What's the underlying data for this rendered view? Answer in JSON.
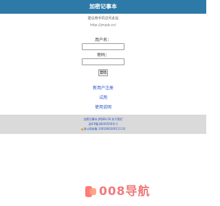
{
  "header": {
    "title": "加密记事本"
  },
  "intro": {
    "tagline": "建议用手机访问此站",
    "url": "http://jmjsb.cn/"
  },
  "login": {
    "username_label": "用户名：",
    "username_value": "",
    "password_label": "密码：",
    "password_value": "",
    "submit_label": "登陆"
  },
  "links": [
    {
      "label": "新用户注册"
    },
    {
      "label": "试用"
    },
    {
      "label": "使用说明"
    }
  ],
  "footer": {
    "line1": "加密记事本  JMJSB.CN  关于我们",
    "line2": "浙ICP备18030556号-1",
    "line3": "浙公网安备 33010602001111号"
  },
  "brand": {
    "text": "008导航"
  },
  "colors": {
    "header_bg": "#2d7aa8",
    "link": "#2251c6",
    "footer_bg": "#dadada",
    "brand": "#f07a7a"
  }
}
